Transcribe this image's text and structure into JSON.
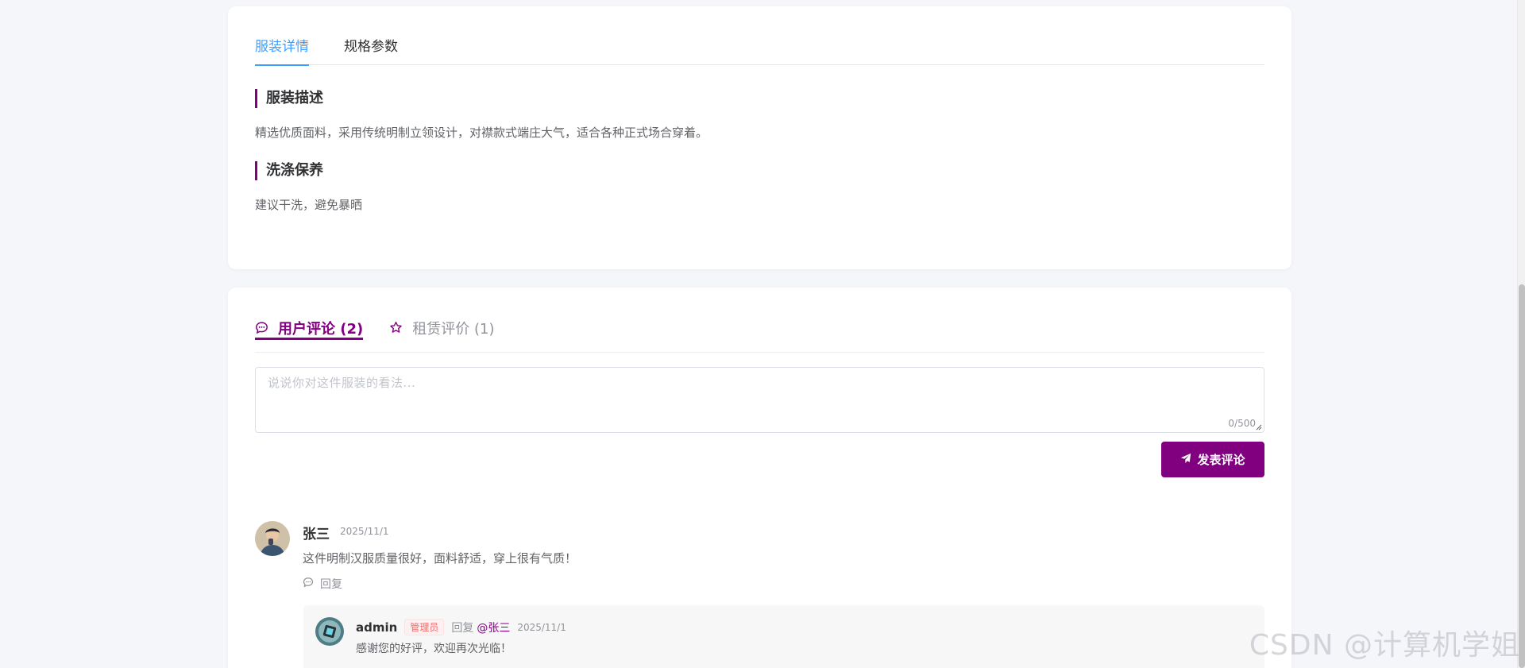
{
  "detail": {
    "tabs": [
      {
        "label": "服装详情",
        "active": true
      },
      {
        "label": "规格参数",
        "active": false
      }
    ],
    "sections": [
      {
        "title": "服装描述",
        "text": "精选优质面料，采用传统明制立领设计，对襟款式端庄大气，适合各种正式场合穿着。"
      },
      {
        "title": "洗涤保养",
        "text": "建议干洗，避免暴晒"
      }
    ]
  },
  "comments": {
    "tabs": [
      {
        "label": "用户评论 (2)",
        "icon": "chat-bubble-icon",
        "active": true
      },
      {
        "label": "租赁评价 (1)",
        "icon": "star-icon",
        "active": false
      }
    ],
    "input": {
      "placeholder": "说说你对这件服装的看法...",
      "value": "",
      "char_count": "0/500"
    },
    "submit_label": "发表评论",
    "list": [
      {
        "author": "张三",
        "date": "2025/11/1",
        "text": "这件明制汉服质量很好，面料舒适，穿上很有气质！",
        "reply_label": "回复",
        "replies": [
          {
            "author": "admin",
            "badge": "管理员",
            "reply_word": "回复",
            "reply_to": "@张三",
            "date": "2025/11/1",
            "text": "感谢您的好评，欢迎再次光临！"
          }
        ]
      }
    ]
  },
  "watermark": "CSDN @计算机学姐",
  "colors": {
    "accent": "#800080",
    "tab_blue": "#409eff",
    "badge_red": "#f56c6c"
  }
}
